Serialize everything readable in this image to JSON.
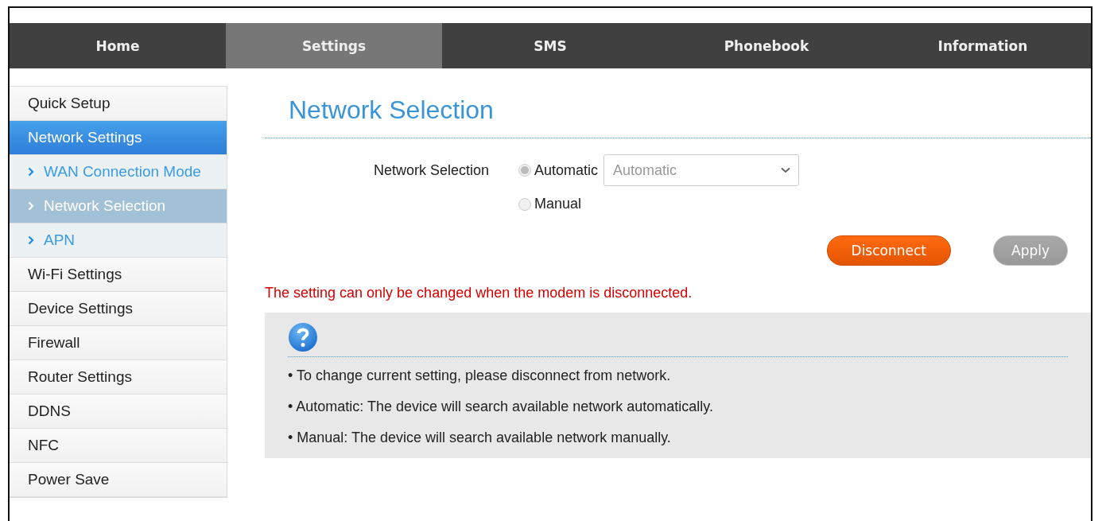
{
  "nav": [
    {
      "label": "Home",
      "selected": false
    },
    {
      "label": "Settings",
      "selected": true
    },
    {
      "label": "SMS",
      "selected": false
    },
    {
      "label": "Phonebook",
      "selected": false
    },
    {
      "label": "Information",
      "selected": false
    }
  ],
  "sidebar": {
    "items": [
      {
        "label": "Quick Setup",
        "selected": false
      },
      {
        "label": "Network Settings",
        "selected": true,
        "children": [
          {
            "label": "WAN Connection Mode",
            "selected": false
          },
          {
            "label": "Network Selection",
            "selected": true
          },
          {
            "label": "APN",
            "selected": false
          }
        ]
      },
      {
        "label": "Wi-Fi Settings",
        "selected": false
      },
      {
        "label": "Device Settings",
        "selected": false
      },
      {
        "label": "Firewall",
        "selected": false
      },
      {
        "label": "Router Settings",
        "selected": false
      },
      {
        "label": "DDNS",
        "selected": false
      },
      {
        "label": "NFC",
        "selected": false
      },
      {
        "label": "Power Save",
        "selected": false
      }
    ]
  },
  "page_title": "Network Selection",
  "form": {
    "label": "Network Selection",
    "options": [
      {
        "label": "Automatic",
        "selected": true,
        "disabled": true
      },
      {
        "label": "Manual",
        "selected": false,
        "disabled": true
      }
    ],
    "dropdown": {
      "value": "Automatic",
      "disabled": true
    }
  },
  "buttons": [
    {
      "label": "Disconnect",
      "disabled": false
    },
    {
      "label": "Apply",
      "disabled": true
    }
  ],
  "warning": "The setting can only be changed when the modem is disconnected.",
  "help": [
    "• To change current setting, please disconnect from network.",
    "• Automatic: The device will search available network automatically.",
    "• Manual: The device will search available network manually."
  ]
}
